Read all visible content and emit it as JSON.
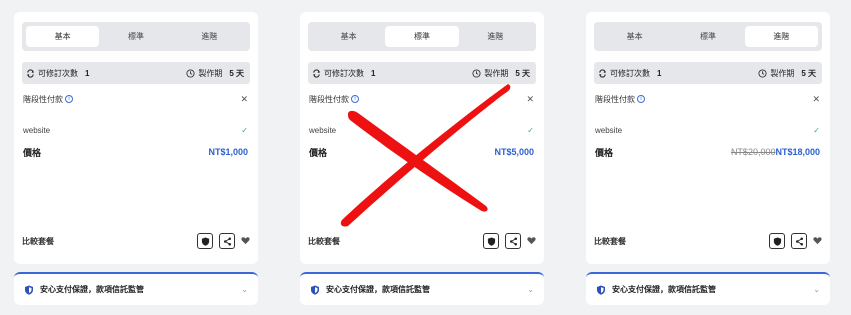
{
  "cards": [
    {
      "tabs": [
        "基本",
        "標準",
        "進階"
      ],
      "active_tab": 0,
      "revisions_label": "可修訂次數",
      "revisions": "1",
      "delivery_label": "製作期",
      "delivery": "5 天",
      "installment_label": "階段性付款",
      "website_label": "website",
      "price_label": "價格",
      "price_original": "",
      "price": "NT$1,000",
      "compare_label": "比較套餐"
    },
    {
      "tabs": [
        "基本",
        "標準",
        "進階"
      ],
      "active_tab": 1,
      "revisions_label": "可修訂次數",
      "revisions": "1",
      "delivery_label": "製作期",
      "delivery": "5 天",
      "installment_label": "階段性付款",
      "website_label": "website",
      "price_label": "價格",
      "price_original": "",
      "price": "NT$5,000",
      "compare_label": "比較套餐"
    },
    {
      "tabs": [
        "基本",
        "標準",
        "進階"
      ],
      "active_tab": 2,
      "revisions_label": "可修訂次數",
      "revisions": "1",
      "delivery_label": "製作期",
      "delivery": "5 天",
      "installment_label": "階段性付款",
      "website_label": "website",
      "price_label": "價格",
      "price_original": "NT$20,000",
      "price": "NT$18,000",
      "compare_label": "比較套餐"
    }
  ],
  "guarantee": {
    "text": "安心支付保證，款項信託監管"
  },
  "icons": {
    "revisions": "refresh-icon",
    "delivery": "clock-icon",
    "info": "info-icon",
    "close": "close-icon",
    "check": "check-icon",
    "report": "shield-icon",
    "share": "share-icon",
    "favorite": "heart-icon",
    "guarantee": "shield-icon",
    "expand": "chevron-down-icon"
  },
  "colors": {
    "price": "#2a60d2",
    "accent": "#3b67d8",
    "cross": "#ee1111"
  }
}
